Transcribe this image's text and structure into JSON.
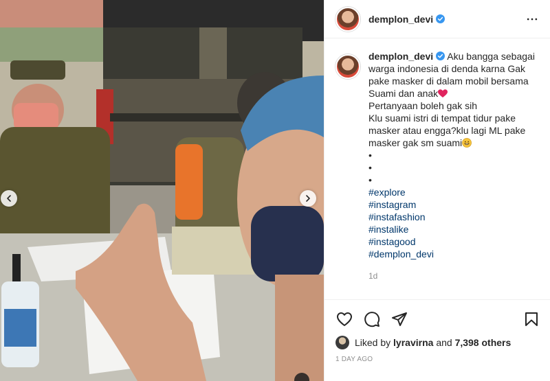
{
  "post": {
    "username": "demplon_devi",
    "verified_icon": "verified-badge-icon",
    "caption": {
      "username": "demplon_devi",
      "lines": [
        "Aku bangga sebagai warga indonesia di denda karna Gak pake masker di dalam mobil bersama Suami dan anak",
        "Pertanyaan boleh gak sih",
        "Klu suami istri di tempat tidur pake masker atau engga?klu lagi ML pake masker gak sm suami"
      ],
      "bullets": [
        "•",
        "•",
        "•"
      ],
      "hashtags": [
        "#explore",
        "#instagram",
        "#instafashion",
        "#instalike",
        "#instagood",
        "#demplon_devi"
      ],
      "time": "1d"
    },
    "likes": {
      "prefix": "Liked by",
      "user": "lyravirna",
      "joiner": "and",
      "others": "7,398 others"
    },
    "date": "1 DAY AGO",
    "colors": {
      "hashtag": "#00376b",
      "verified": "#3897f0",
      "heart": "#e0245e"
    },
    "icons": [
      "heart-icon",
      "comment-icon",
      "share-icon",
      "bookmark-icon",
      "more-icon",
      "chevron-left-icon",
      "chevron-right-icon"
    ]
  }
}
